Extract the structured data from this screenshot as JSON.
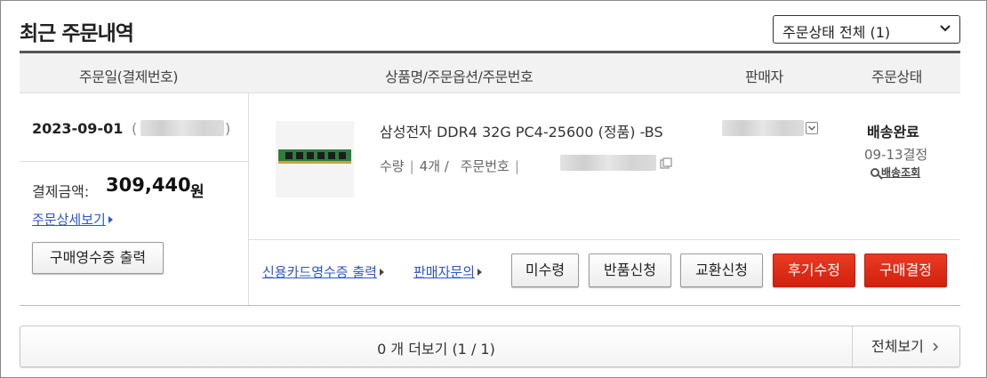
{
  "page": {
    "title": "최근 주문내역",
    "status_filter": "주문상태 전체 (1)"
  },
  "table_header": {
    "order_date": "주문일(결제번호)",
    "product": "상품명/주문옵션/주문번호",
    "seller": "판매자",
    "status": "주문상태"
  },
  "order": {
    "date": "2023-09-01",
    "paren_open": "(",
    "paren_close": ")",
    "payment_label": "결제금액:",
    "payment_amount": "309,440",
    "payment_unit": "원",
    "detail_link": "주문상세보기",
    "receipt_button": "구매영수증 출력",
    "product_name": "삼성전자 DDR4 32G PC4-25600 (정품) -BS",
    "qty_label": "수량",
    "qty_value": "4개 /",
    "order_number_label": "주문번호",
    "status_main": "배송완료",
    "status_date": "09-13결정",
    "track_link": "배송조회"
  },
  "actions": {
    "card_receipt": "신용카드영수증 출력",
    "seller_inquiry": "판매자문의",
    "not_received": "미수령",
    "return": "반품신청",
    "exchange": "교환신청",
    "review": "후기수정",
    "confirm": "구매결정"
  },
  "footer": {
    "more": "0 개 더보기 (1 / 1)",
    "view_all": "전체보기"
  },
  "colors": {
    "accent_red": "#d2200d",
    "link_blue": "#2d55c9",
    "header_bg": "#f2f2f2"
  },
  "icons": [
    "chevron-down-icon",
    "copy-icon",
    "dropdown-box-icon",
    "magnifier-icon",
    "triangle-right-icon",
    "chevron-right-icon"
  ]
}
